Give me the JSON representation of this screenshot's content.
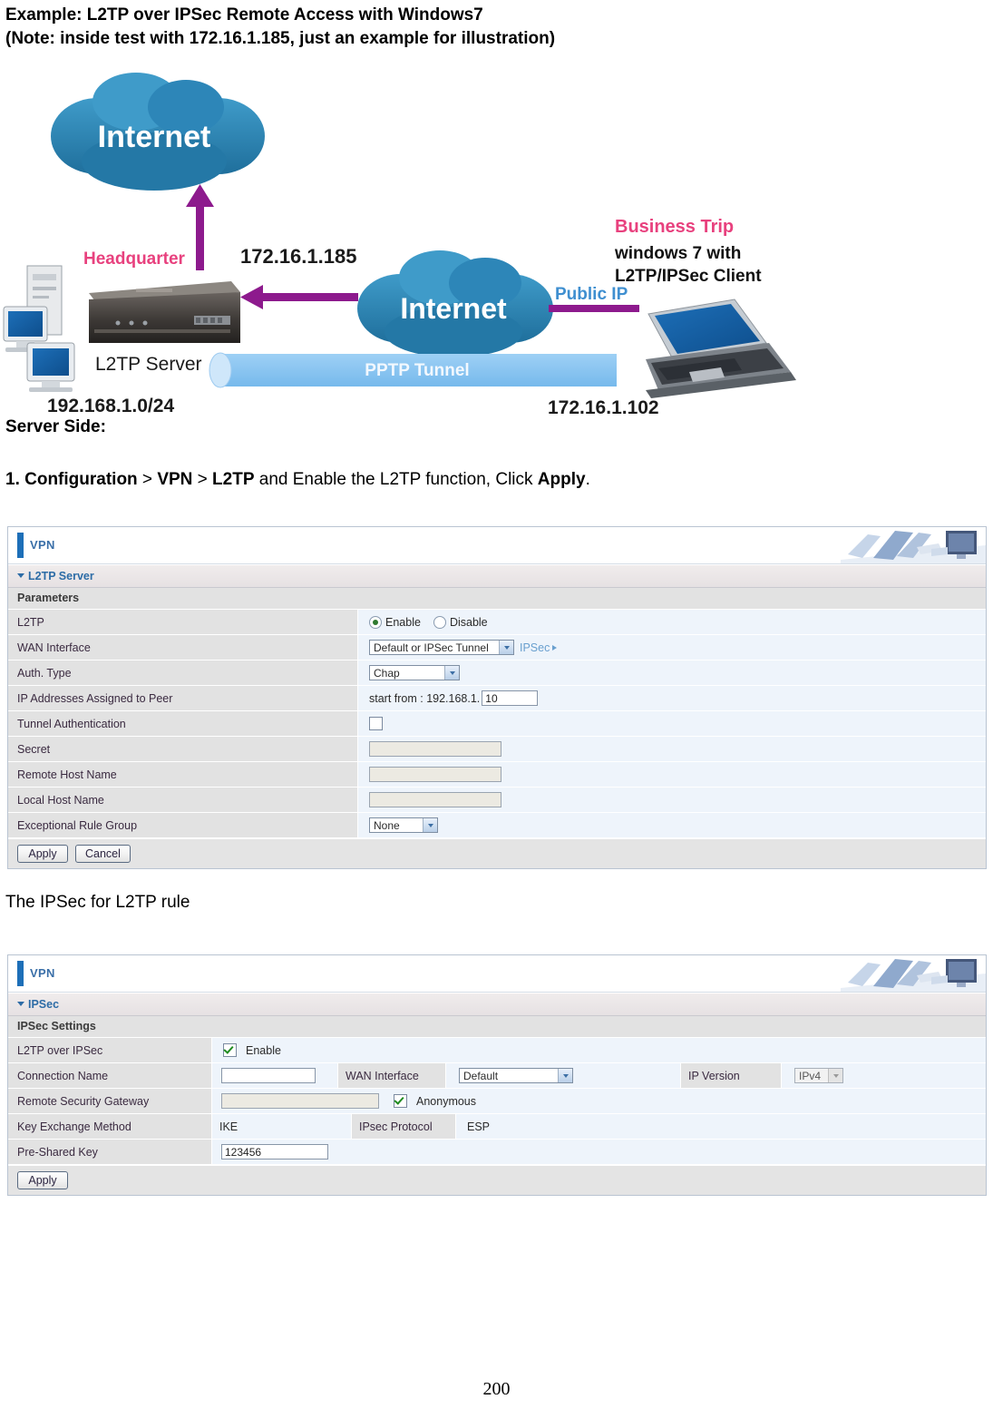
{
  "document": {
    "title_line1": "Example: L2TP over IPSec Remote Access with Windows7",
    "title_line2": "(Note: inside test with 172.16.1.185, just an example for illustration)",
    "server_side_heading": "Server Side:",
    "step1": {
      "bold1": "1. Configuration",
      "sep1": " > ",
      "bold2": "VPN",
      "sep2": " > ",
      "bold3": "L2TP",
      "text_mid": " and Enable the L2TP function, Click ",
      "bold4": "Apply",
      "text_end": "."
    },
    "ipsec_caption": "The IPSec for L2TP rule",
    "page_number": "200"
  },
  "diagram": {
    "cloud_left_label": "Internet",
    "cloud_right_label": "Internet",
    "headquarter_label": "Headquarter",
    "l2tp_server_label": "L2TP Server",
    "lan_subnet_label": "192.168.1.0/24",
    "wan_ip_label": "172.16.1.185",
    "tunnel_label": "PPTP Tunnel",
    "client_ip_label": "172.16.1.102",
    "public_ip_label": "Public IP",
    "business_trip_label": "Business Trip",
    "client_line1": "windows 7 with",
    "client_line2": "L2TP/IPSec Client",
    "colors": {
      "cloud": "#2f86b5",
      "arrow": "#8d1a8d",
      "tunnel": "#86c3ef",
      "pink": "#e8417e",
      "public_ip": "#3f8fd0"
    }
  },
  "panel_l2tp": {
    "banner_title": "VPN",
    "accordion_label": "L2TP Server",
    "section_label": "Parameters",
    "rows": {
      "l2tp": {
        "label": "L2TP",
        "enable_label": "Enable",
        "disable_label": "Disable",
        "selected": "Enable"
      },
      "wan_interface": {
        "label": "WAN Interface",
        "value": "Default or IPSec Tunnel",
        "link": "IPSec"
      },
      "auth_type": {
        "label": "Auth. Type",
        "value": "Chap"
      },
      "ip_addresses": {
        "label": "IP Addresses Assigned to Peer",
        "prefix": "start from : 192.168.1.",
        "value": "10"
      },
      "tunnel_auth": {
        "label": "Tunnel Authentication",
        "checked": false
      },
      "secret": {
        "label": "Secret",
        "value": ""
      },
      "remote_host": {
        "label": "Remote Host Name",
        "value": ""
      },
      "local_host": {
        "label": "Local Host Name",
        "value": ""
      },
      "exceptional_rule": {
        "label": "Exceptional Rule Group",
        "value": "None"
      }
    },
    "apply_label": "Apply",
    "cancel_label": "Cancel"
  },
  "panel_ipsec": {
    "banner_title": "VPN",
    "accordion_label": "IPSec",
    "section_label": "IPSec Settings",
    "rows": {
      "l2tp_over_ipsec": {
        "label": "L2TP over IPSec",
        "enable_label": "Enable",
        "checked": true
      },
      "connection_name": {
        "label": "Connection Name",
        "value": "",
        "wan_label": "WAN Interface",
        "wan_value": "Default",
        "ipver_label": "IP Version",
        "ipver_value": "IPv4"
      },
      "remote_gateway": {
        "label": "Remote Security Gateway",
        "value": "",
        "anonymous_label": "Anonymous",
        "anonymous_checked": true
      },
      "key_exchange": {
        "label": "Key Exchange Method",
        "value": "IKE",
        "protocol_label": "IPsec Protocol",
        "protocol_value": "ESP"
      },
      "preshared_key": {
        "label": "Pre-Shared Key",
        "value": "123456"
      }
    },
    "apply_label": "Apply"
  }
}
